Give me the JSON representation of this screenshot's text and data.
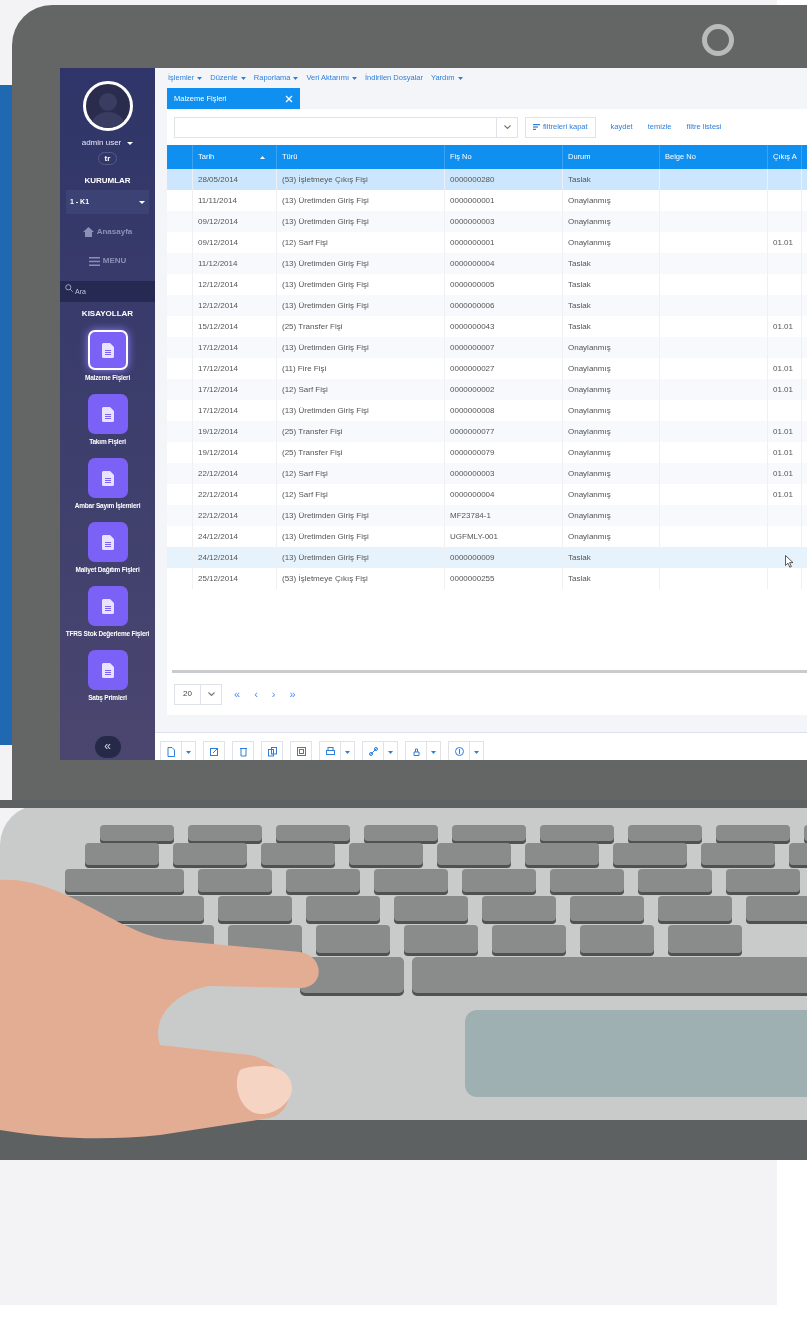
{
  "sidebar": {
    "user": "admin user",
    "language": "tr",
    "org_heading": "KURUMLAR",
    "org_select": "1 - K1",
    "home": "Anasayfa",
    "menu": "MENU",
    "search_placeholder": "Ara",
    "shortcuts_heading": "KISAYOLLAR",
    "shortcuts": [
      {
        "label": "Malzeme Fişleri",
        "selected": true
      },
      {
        "label": "Takım Fişleri",
        "selected": false
      },
      {
        "label": "Ambar Sayım İşlemleri",
        "selected": false
      },
      {
        "label": "Maliyet Dağıtım Fişleri",
        "selected": false
      },
      {
        "label": "TFRS Stok Değerleme Fişleri",
        "selected": false
      },
      {
        "label": "Satış Primleri",
        "selected": false
      }
    ],
    "collapse": "«"
  },
  "menu_bar": [
    {
      "label": "İşlemler",
      "dropdown": true
    },
    {
      "label": "Düzenle",
      "dropdown": true
    },
    {
      "label": "Raporlama",
      "dropdown": true
    },
    {
      "label": "Veri Aktarımı",
      "dropdown": true
    },
    {
      "label": "İndirilen Dosyalar",
      "dropdown": false
    },
    {
      "label": "Yardım",
      "dropdown": true
    }
  ],
  "tabs": [
    {
      "label": "Malzeme Fişleri",
      "selected": true
    }
  ],
  "filter_bar": {
    "filter_toggle": "filtreleri kapat",
    "links": [
      "kaydet",
      "temizle",
      "filtre listesi"
    ]
  },
  "table": {
    "columns": [
      {
        "label": "Tarih",
        "sorted": true
      },
      {
        "label": "Türü",
        "sorted": false
      },
      {
        "label": "Fiş No",
        "sorted": false
      },
      {
        "label": "Durum",
        "sorted": false
      },
      {
        "label": "Belge No",
        "sorted": false
      },
      {
        "label": "Çıkış A",
        "sorted": false
      }
    ],
    "rows": [
      {
        "cells": [
          "28/05/2014",
          "(53) İşletmeye Çıkış Fişi",
          "0000000280",
          "Taslak",
          "",
          ""
        ],
        "selected": true,
        "hovered": false
      },
      {
        "cells": [
          "11/11/2014",
          "(13) Üretimden Giriş Fişi",
          "0000000001",
          "Onaylanmış",
          "",
          ""
        ],
        "selected": false,
        "hovered": false
      },
      {
        "cells": [
          "09/12/2014",
          "(13) Üretimden Giriş Fişi",
          "0000000003",
          "Onaylanmış",
          "",
          ""
        ],
        "selected": false,
        "hovered": false
      },
      {
        "cells": [
          "09/12/2014",
          "(12) Sarf Fişi",
          "0000000001",
          "Onaylanmış",
          "",
          "01.01"
        ],
        "selected": false,
        "hovered": false
      },
      {
        "cells": [
          "11/12/2014",
          "(13) Üretimden Giriş Fişi",
          "0000000004",
          "Taslak",
          "",
          ""
        ],
        "selected": false,
        "hovered": false
      },
      {
        "cells": [
          "12/12/2014",
          "(13) Üretimden Giriş Fişi",
          "0000000005",
          "Taslak",
          "",
          ""
        ],
        "selected": false,
        "hovered": false
      },
      {
        "cells": [
          "12/12/2014",
          "(13) Üretimden Giriş Fişi",
          "0000000006",
          "Taslak",
          "",
          ""
        ],
        "selected": false,
        "hovered": false
      },
      {
        "cells": [
          "15/12/2014",
          "(25) Transfer Fişi",
          "0000000043",
          "Taslak",
          "",
          "01.01"
        ],
        "selected": false,
        "hovered": false
      },
      {
        "cells": [
          "17/12/2014",
          "(13) Üretimden Giriş Fişi",
          "0000000007",
          "Onaylanmış",
          "",
          ""
        ],
        "selected": false,
        "hovered": false
      },
      {
        "cells": [
          "17/12/2014",
          "(11) Fire Fişi",
          "0000000027",
          "Onaylanmış",
          "",
          "01.01"
        ],
        "selected": false,
        "hovered": false
      },
      {
        "cells": [
          "17/12/2014",
          "(12) Sarf Fişi",
          "0000000002",
          "Onaylanmış",
          "",
          "01.01"
        ],
        "selected": false,
        "hovered": false
      },
      {
        "cells": [
          "17/12/2014",
          "(13) Üretimden Giriş Fişi",
          "0000000008",
          "Onaylanmış",
          "",
          ""
        ],
        "selected": false,
        "hovered": false
      },
      {
        "cells": [
          "19/12/2014",
          "(25) Transfer Fişi",
          "0000000077",
          "Onaylanmış",
          "",
          "01.01"
        ],
        "selected": false,
        "hovered": false
      },
      {
        "cells": [
          "19/12/2014",
          "(25) Transfer Fişi",
          "0000000079",
          "Onaylanmış",
          "",
          "01.01"
        ],
        "selected": false,
        "hovered": false
      },
      {
        "cells": [
          "22/12/2014",
          "(12) Sarf Fişi",
          "0000000003",
          "Onaylanmış",
          "",
          "01.01"
        ],
        "selected": false,
        "hovered": false
      },
      {
        "cells": [
          "22/12/2014",
          "(12) Sarf Fişi",
          "0000000004",
          "Onaylanmış",
          "",
          "01.01"
        ],
        "selected": false,
        "hovered": false
      },
      {
        "cells": [
          "22/12/2014",
          "(13) Üretimden Giriş Fişi",
          "MF23784-1",
          "Onaylanmış",
          "",
          ""
        ],
        "selected": false,
        "hovered": false
      },
      {
        "cells": [
          "24/12/2014",
          "(13) Üretimden Giriş Fişi",
          "UGFMLY-001",
          "Onaylanmış",
          "",
          ""
        ],
        "selected": false,
        "hovered": false
      },
      {
        "cells": [
          "24/12/2014",
          "(13) Üretimden Giriş Fişi",
          "0000000009",
          "Taslak",
          "",
          ""
        ],
        "selected": false,
        "hovered": true
      },
      {
        "cells": [
          "25/12/2014",
          "(53) İşletmeye Çıkış Fişi",
          "0000000255",
          "Taslak",
          "",
          ""
        ],
        "selected": false,
        "hovered": false
      }
    ]
  },
  "pagination": {
    "page_size": "20",
    "nav": [
      "«",
      "‹",
      "›",
      "»"
    ]
  },
  "bottom_toolbar": [
    {
      "dropdown": true
    },
    {
      "dropdown": false
    },
    {
      "dropdown": false
    },
    {
      "dropdown": false
    },
    {
      "dropdown": false
    },
    {
      "dropdown": true
    },
    {
      "dropdown": true
    },
    {
      "dropdown": true
    },
    {
      "dropdown": true
    }
  ]
}
